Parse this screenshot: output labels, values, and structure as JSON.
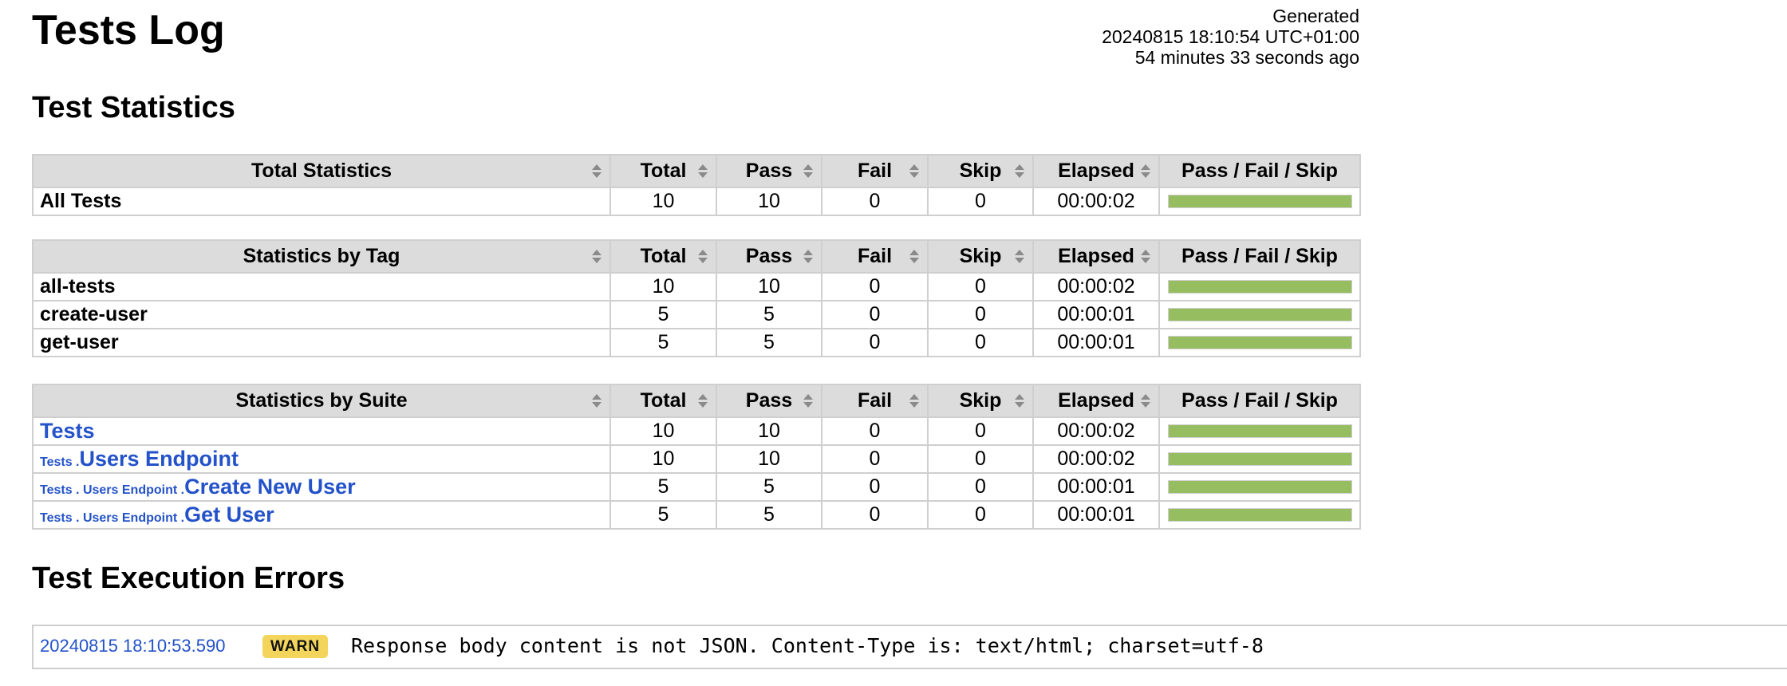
{
  "title": "Tests Log",
  "generated": {
    "label": "Generated",
    "timestamp": "20240815 18:10:54 UTC+01:00",
    "ago": "54 minutes 33 seconds ago"
  },
  "sections": {
    "statistics": "Test Statistics",
    "errors": "Test Execution Errors"
  },
  "columns": {
    "total": "Total",
    "pass": "Pass",
    "fail": "Fail",
    "skip": "Skip",
    "elapsed": "Elapsed",
    "graph": "Pass / Fail / Skip"
  },
  "total_stats": {
    "header": "Total Statistics",
    "rows": [
      {
        "name": "All Tests",
        "total": "10",
        "pass": "10",
        "fail": "0",
        "skip": "0",
        "elapsed": "00:00:02",
        "pass_ratio": 1.0
      }
    ]
  },
  "tag_stats": {
    "header": "Statistics by Tag",
    "rows": [
      {
        "name": "all-tests",
        "total": "10",
        "pass": "10",
        "fail": "0",
        "skip": "0",
        "elapsed": "00:00:02",
        "pass_ratio": 1.0
      },
      {
        "name": "create-user",
        "total": "5",
        "pass": "5",
        "fail": "0",
        "skip": "0",
        "elapsed": "00:00:01",
        "pass_ratio": 1.0
      },
      {
        "name": "get-user",
        "total": "5",
        "pass": "5",
        "fail": "0",
        "skip": "0",
        "elapsed": "00:00:01",
        "pass_ratio": 1.0
      }
    ]
  },
  "suite_stats": {
    "header": "Statistics by Suite",
    "rows": [
      {
        "parent": "",
        "name": "Tests",
        "total": "10",
        "pass": "10",
        "fail": "0",
        "skip": "0",
        "elapsed": "00:00:02",
        "pass_ratio": 1.0
      },
      {
        "parent": "Tests .",
        "name": "Users Endpoint",
        "total": "10",
        "pass": "10",
        "fail": "0",
        "skip": "0",
        "elapsed": "00:00:02",
        "pass_ratio": 1.0
      },
      {
        "parent": "Tests . Users Endpoint .",
        "name": "Create New User",
        "total": "5",
        "pass": "5",
        "fail": "0",
        "skip": "0",
        "elapsed": "00:00:01",
        "pass_ratio": 1.0
      },
      {
        "parent": "Tests . Users Endpoint .",
        "name": "Get User",
        "total": "5",
        "pass": "5",
        "fail": "0",
        "skip": "0",
        "elapsed": "00:00:01",
        "pass_ratio": 1.0
      }
    ]
  },
  "errors": [
    {
      "time": "20240815 18:10:53.590",
      "level": "WARN",
      "message": "Response body content is not JSON. Content-Type is: text/html; charset=utf-8"
    }
  ],
  "colors": {
    "pass_bar": "#97bd61",
    "link": "#2352c9",
    "warn_badge": "#f2d55a",
    "header_bg": "#dcdcdc"
  },
  "icons": {
    "sort": "sort-arrows-icon"
  }
}
